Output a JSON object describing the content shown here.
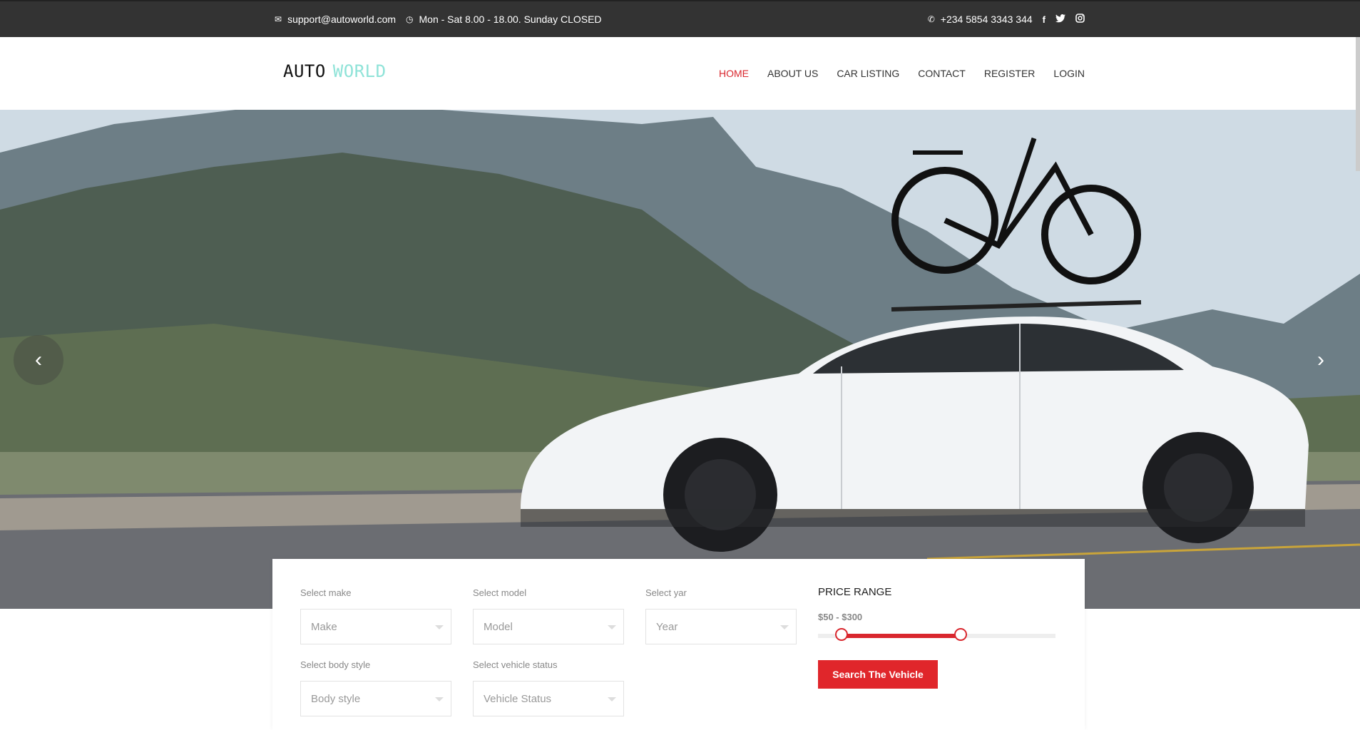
{
  "topbar": {
    "email": "support@autoworld.com",
    "hours": "Mon - Sat 8.00 - 18.00. Sunday CLOSED",
    "phone": "+234 5854 3343 344",
    "social": [
      "f",
      "t",
      "ig"
    ]
  },
  "logo": {
    "part1": "AUTO",
    "part2": "WORLD"
  },
  "nav": [
    "HOME",
    "ABOUT US",
    "CAR LISTING",
    "CONTACT",
    "REGISTER",
    "LOGIN"
  ],
  "hero": {
    "prev": "‹",
    "next": "›"
  },
  "search": {
    "make_label": "Select make",
    "make_value": "Make",
    "model_label": "Select model",
    "model_value": "Model",
    "year_label": "Select yar",
    "year_value": "Year",
    "body_label": "Select body style",
    "body_value": "Body style",
    "status_label": "Select vehicle status",
    "status_value": "Vehicle Status",
    "price_title": "PRICE RANGE",
    "price_range": "$50 - $300",
    "price_min_fraction": 0.1,
    "price_max_fraction": 0.6,
    "button": "Search The Vehicle"
  },
  "colors": {
    "accent": "#d9272e",
    "logo_accent": "#8fe3d8",
    "topbar": "#333333"
  }
}
